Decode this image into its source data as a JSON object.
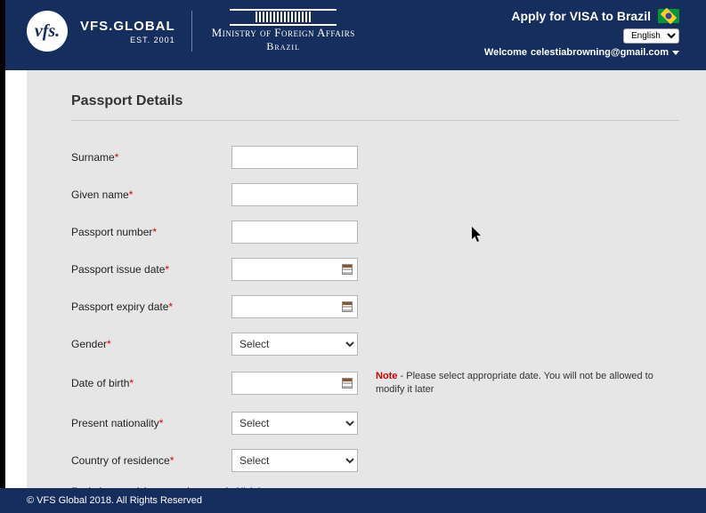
{
  "header": {
    "logo_text": "vfs.",
    "brand_line1": "VFS.GLOBAL",
    "brand_line2": "EST. 2001",
    "ministry_line1": "Ministry of Foreign Affairs",
    "ministry_line2": "Brazil",
    "apply_text": "Apply for VISA to Brazil",
    "language_value": "English",
    "welcome_prefix": "Welcome ",
    "welcome_user": "celestiabrowning@gmail.com"
  },
  "section": {
    "title": "Passport Details"
  },
  "form": {
    "surname": {
      "label": "Surname",
      "required": true,
      "value": ""
    },
    "given": {
      "label": "Given name",
      "required": true,
      "value": ""
    },
    "ppnum": {
      "label": "Passport number",
      "required": true,
      "value": ""
    },
    "issue": {
      "label": "Passport issue date",
      "required": true,
      "value": ""
    },
    "expiry": {
      "label": "Passport expiry date",
      "required": true,
      "value": ""
    },
    "gender": {
      "label": "Gender",
      "required": true,
      "value": "Select"
    },
    "dob": {
      "label": "Date of birth",
      "required": true,
      "value": ""
    },
    "natl": {
      "label": "Present nationality",
      "required": true,
      "value": "Select"
    },
    "residence": {
      "label": "Country of residence",
      "required": true,
      "value": "Select"
    }
  },
  "note": {
    "bold": "Note",
    "text": " - Please select appropriate date. You will not be allowed to modify it later"
  },
  "help": {
    "prefix": "For help on resizing your photograph ",
    "link": "Click here"
  },
  "footer": {
    "text": "© VFS Global 2018. All Rights Reserved"
  },
  "asterisk": "*"
}
